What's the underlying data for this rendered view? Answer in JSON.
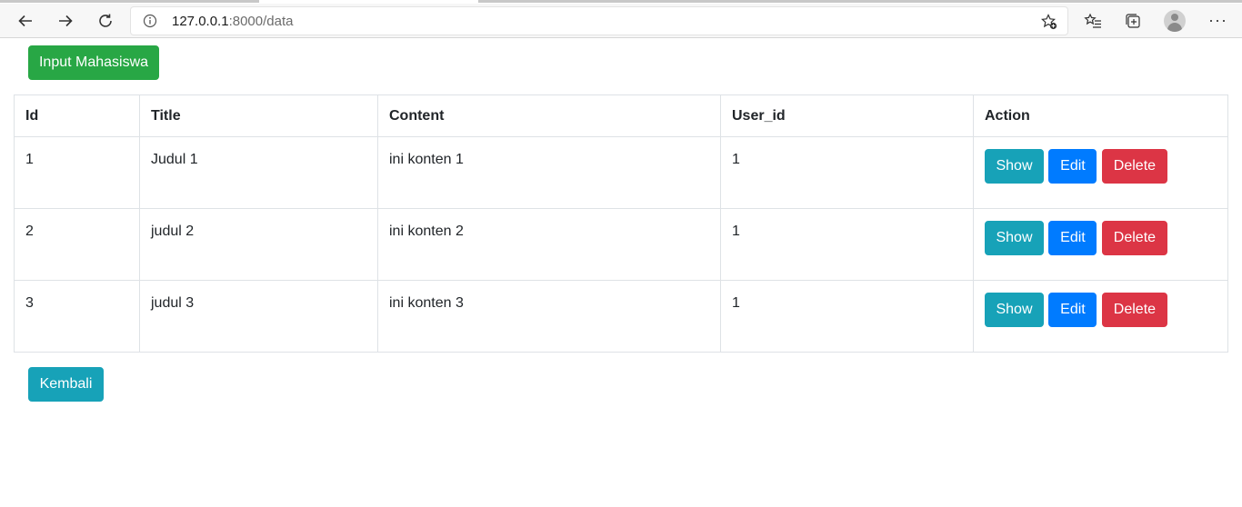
{
  "browser": {
    "url_host": "127.0.0.1",
    "url_path": ":8000/data"
  },
  "page": {
    "input_button": "Input Mahasiswa",
    "back_button": "Kembali"
  },
  "table": {
    "headers": [
      "Id",
      "Title",
      "Content",
      "User_id",
      "Action"
    ],
    "rows": [
      {
        "id": "1",
        "title": "Judul 1",
        "content": "ini konten 1",
        "user_id": "1"
      },
      {
        "id": "2",
        "title": "judul 2",
        "content": "ini konten 2",
        "user_id": "1"
      },
      {
        "id": "3",
        "title": "judul 3",
        "content": "ini konten 3",
        "user_id": "1"
      }
    ],
    "actions": {
      "show": "Show",
      "edit": "Edit",
      "delete": "Delete"
    }
  },
  "colors": {
    "success": "#28a745",
    "info": "#17a2b8",
    "primary": "#007bff",
    "danger": "#dc3545"
  }
}
